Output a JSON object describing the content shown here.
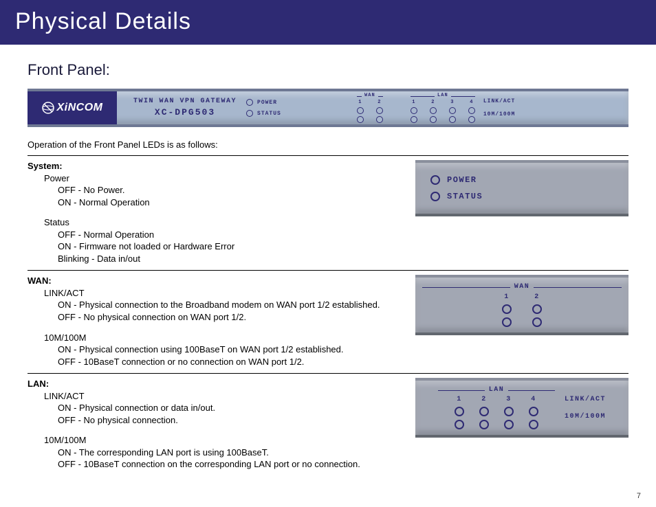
{
  "page": {
    "title": "Physical Details",
    "section": "Front Panel:",
    "intro": "Operation of the Front Panel LEDs is as follows:",
    "number": "7"
  },
  "brand": {
    "name": "XiNCOM",
    "product_line": "TWIN WAN VPN GATEWAY",
    "model": "XC-DPG503"
  },
  "panel_labels": {
    "power": "POWER",
    "status": "STATUS",
    "wan": "WAN",
    "lan": "LAN",
    "linkact": "LINK/ACT",
    "speed": "10M/100M",
    "p1": "1",
    "p2": "2",
    "p3": "3",
    "p4": "4"
  },
  "system": {
    "header": "System:",
    "power_label": "Power",
    "power_off": "OFF - No Power.",
    "power_on": "ON - Normal Operation",
    "status_label": "Status",
    "status_off": "OFF - Normal Operation",
    "status_on": "ON - Firmware not loaded or Hardware Error",
    "status_blink": "Blinking - Data in/out"
  },
  "wan": {
    "header": "WAN:",
    "link_label": "LINK/ACT",
    "link_on": "ON - Physical connection to the Broadband modem on WAN port 1/2 established.",
    "link_off": "OFF - No physical connection on WAN port 1/2.",
    "spd_label": "10M/100M",
    "spd_on": "ON - Physical connection using 100BaseT on WAN port 1/2 established.",
    "spd_off": "OFF - 10BaseT connection or no connection on WAN port 1/2."
  },
  "lan": {
    "header": "LAN:",
    "link_label": "LINK/ACT",
    "link_on": "ON - Physical connection or data in/out.",
    "link_off": "OFF - No physical connection.",
    "spd_label": "10M/100M",
    "spd_on": "ON - The corresponding LAN port is using 100BaseT.",
    "spd_off": "OFF - 10BaseT connection on the corresponding LAN port or no connection."
  }
}
